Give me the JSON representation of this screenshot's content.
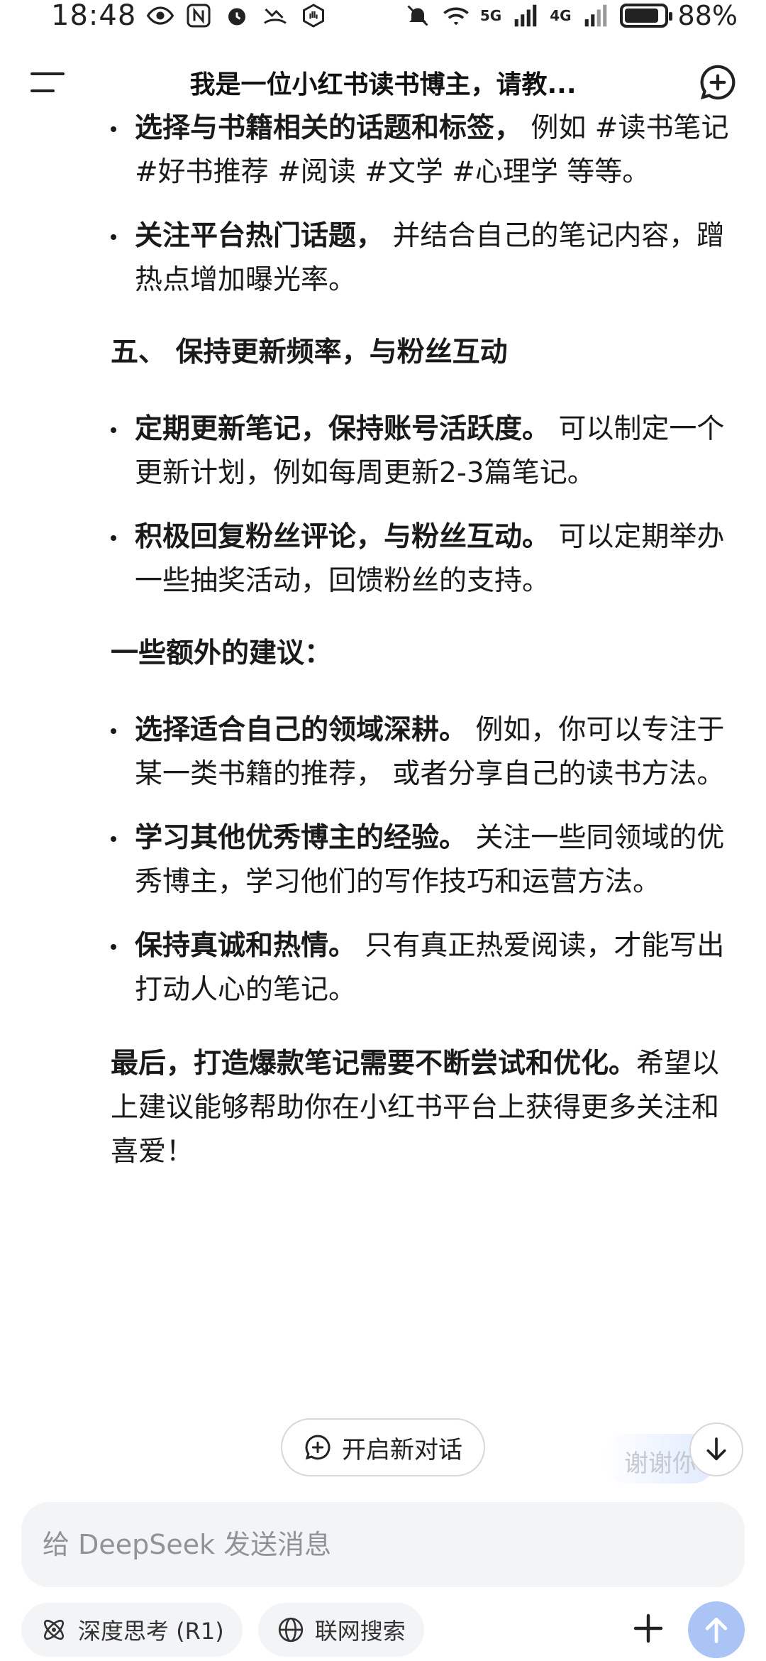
{
  "status_bar": {
    "time": "18:48",
    "net_5g": "5G",
    "net_4g": "4G",
    "battery_percent": "88%",
    "battery_level": 0.88
  },
  "header": {
    "title": "我是一位小红书读书博主，请教..."
  },
  "content": {
    "bullets_top": [
      {
        "bold": "选择与书籍相关的话题和标签，",
        "text": " 例如 #读书笔记 #好书推荐 #阅读 #文学 #心理学 等等。"
      },
      {
        "bold": "关注平台热门话题，",
        "text": " 并结合自己的笔记内容，蹭热点增加曝光率。"
      }
    ],
    "section5_heading": "五、 保持更新频率，与粉丝互动",
    "bullets_section5": [
      {
        "bold": "定期更新笔记，保持账号活跃度。",
        "text": " 可以制定一个更新计划，例如每周更新2-3篇笔记。"
      },
      {
        "bold": "积极回复粉丝评论，与粉丝互动。",
        "text": " 可以定期举办一些抽奖活动，回馈粉丝的支持。"
      }
    ],
    "extra_heading": "一些额外的建议：",
    "bullets_extra": [
      {
        "bold": "选择适合自己的领域深耕。",
        "text": " 例如，你可以专注于某一类书籍的推荐， 或者分享自己的读书方法。"
      },
      {
        "bold": "学习其他优秀博主的经验。",
        "text": " 关注一些同领域的优秀博主，学习他们的写作技巧和运营方法。"
      },
      {
        "bold": "保持真诚和热情。",
        "text": " 只有真正热爱阅读，才能写出打动人心的笔记。"
      }
    ],
    "closing_bold": "最后，打造爆款笔记需要不断尝试和优化。",
    "closing_text": "希望以上建议能够帮助你在小红书平台上获得更多关注和喜爱！"
  },
  "new_chat_label": "开启新对话",
  "suggestion_ghost": "谢谢你",
  "input": {
    "placeholder": "给 DeepSeek 发送消息",
    "value": ""
  },
  "toolbar": {
    "deep_think_label": "深度思考 (R1)",
    "web_search_label": "联网搜索"
  },
  "icons": {
    "menu": "menu-icon",
    "new_chat": "new-chat-icon",
    "scroll_down": "arrow-down-icon",
    "plus": "plus-icon",
    "send": "send-arrow-icon",
    "deep_think": "atom-icon",
    "web_search": "globe-icon"
  },
  "colors": {
    "send_button": "#a9c4f5",
    "input_bg": "#f3f4f6"
  }
}
